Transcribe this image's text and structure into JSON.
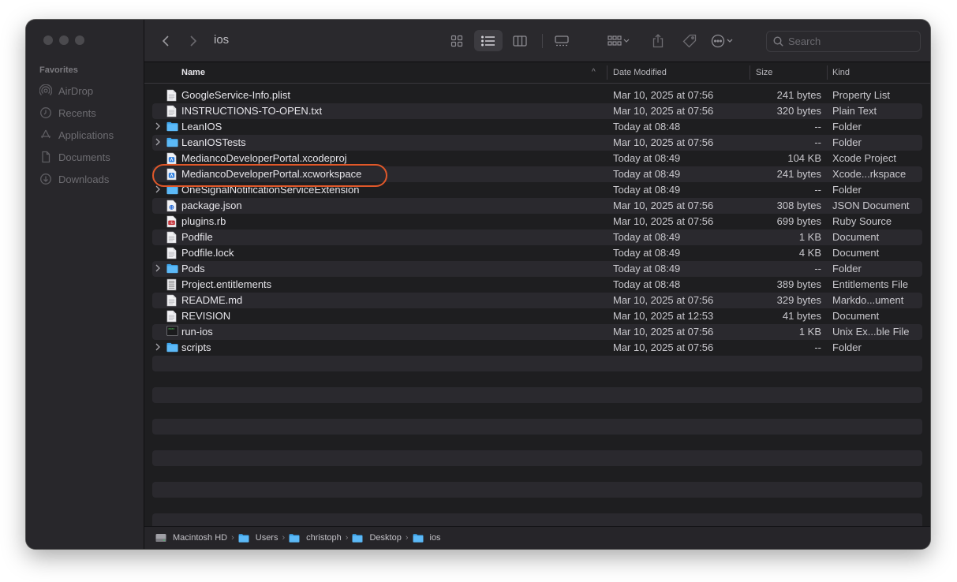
{
  "sidebar": {
    "section_title": "Favorites",
    "items": [
      {
        "label": "AirDrop",
        "icon": "airdrop-icon"
      },
      {
        "label": "Recents",
        "icon": "clock-icon"
      },
      {
        "label": "Applications",
        "icon": "applications-icon"
      },
      {
        "label": "Documents",
        "icon": "document-icon"
      },
      {
        "label": "Downloads",
        "icon": "download-icon"
      }
    ]
  },
  "toolbar": {
    "title": "ios",
    "search_placeholder": "Search"
  },
  "columns": {
    "name": "Name",
    "date": "Date Modified",
    "size": "Size",
    "kind": "Kind"
  },
  "files": [
    {
      "name": "GoogleService-Info.plist",
      "date": "Mar 10, 2025 at 07:56",
      "size": "241 bytes",
      "kind": "Property List",
      "icon": "plist-file-icon",
      "folder": false
    },
    {
      "name": "INSTRUCTIONS-TO-OPEN.txt",
      "date": "Mar 10, 2025 at 07:56",
      "size": "320 bytes",
      "kind": "Plain Text",
      "icon": "text-file-icon",
      "folder": false
    },
    {
      "name": "LeanIOS",
      "date": "Today at 08:48",
      "size": "--",
      "kind": "Folder",
      "icon": "folder-icon",
      "folder": true
    },
    {
      "name": "LeanIOSTests",
      "date": "Mar 10, 2025 at 07:56",
      "size": "--",
      "kind": "Folder",
      "icon": "folder-icon",
      "folder": true
    },
    {
      "name": "MediancoDeveloperPortal.xcodeproj",
      "date": "Today at 08:49",
      "size": "104 KB",
      "kind": "Xcode Project",
      "icon": "xcode-project-icon",
      "folder": false
    },
    {
      "name": "MediancoDeveloperPortal.xcworkspace",
      "date": "Today at 08:49",
      "size": "241 bytes",
      "kind": "Xcode...rkspace",
      "icon": "xcode-workspace-icon",
      "folder": false
    },
    {
      "name": "OneSignalNotificationServiceExtension",
      "date": "Today at 08:49",
      "size": "--",
      "kind": "Folder",
      "icon": "folder-icon",
      "folder": true
    },
    {
      "name": "package.json",
      "date": "Mar 10, 2025 at 07:56",
      "size": "308 bytes",
      "kind": "JSON Document",
      "icon": "json-file-icon",
      "folder": false
    },
    {
      "name": "plugins.rb",
      "date": "Mar 10, 2025 at 07:56",
      "size": "699 bytes",
      "kind": "Ruby Source",
      "icon": "ruby-file-icon",
      "folder": false
    },
    {
      "name": "Podfile",
      "date": "Today at 08:49",
      "size": "1 KB",
      "kind": "Document",
      "icon": "document-file-icon",
      "folder": false
    },
    {
      "name": "Podfile.lock",
      "date": "Today at 08:49",
      "size": "4 KB",
      "kind": "Document",
      "icon": "document-file-icon",
      "folder": false
    },
    {
      "name": "Pods",
      "date": "Today at 08:49",
      "size": "--",
      "kind": "Folder",
      "icon": "folder-icon",
      "folder": true
    },
    {
      "name": "Project.entitlements",
      "date": "Today at 08:48",
      "size": "389 bytes",
      "kind": "Entitlements File",
      "icon": "entitlements-file-icon",
      "folder": false
    },
    {
      "name": "README.md",
      "date": "Mar 10, 2025 at 07:56",
      "size": "329 bytes",
      "kind": "Markdo...ument",
      "icon": "markdown-file-icon",
      "folder": false
    },
    {
      "name": "REVISION",
      "date": "Mar 10, 2025 at 12:53",
      "size": "41 bytes",
      "kind": "Document",
      "icon": "document-file-icon",
      "folder": false
    },
    {
      "name": "run-ios",
      "date": "Mar 10, 2025 at 07:56",
      "size": "1 KB",
      "kind": "Unix Ex...ble File",
      "icon": "terminal-file-icon",
      "folder": false
    },
    {
      "name": "scripts",
      "date": "Mar 10, 2025 at 07:56",
      "size": "--",
      "kind": "Folder",
      "icon": "folder-icon",
      "folder": true
    }
  ],
  "highlighted_file": "MediancoDeveloperPortal.xcworkspace",
  "highlight_color": "#e0582a",
  "path": [
    {
      "label": "Macintosh HD",
      "icon": "hard-drive-icon"
    },
    {
      "label": "Users",
      "icon": "folder-icon"
    },
    {
      "label": "christoph",
      "icon": "folder-icon"
    },
    {
      "label": "Desktop",
      "icon": "folder-icon"
    },
    {
      "label": "ios",
      "icon": "folder-icon"
    }
  ]
}
